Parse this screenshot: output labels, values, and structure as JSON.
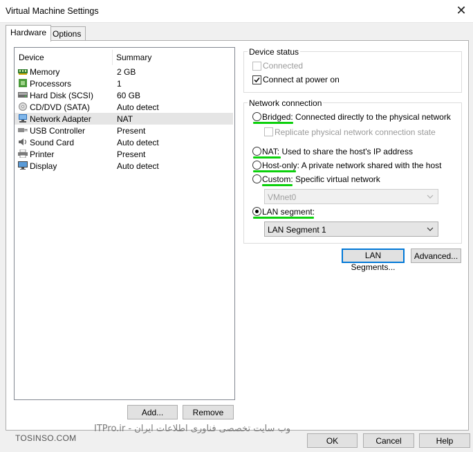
{
  "window": {
    "title": "Virtual Machine Settings",
    "close_glyph": "✕"
  },
  "tabs": [
    {
      "label": "Hardware"
    },
    {
      "label": "Options"
    }
  ],
  "device_list": {
    "col_device": "Device",
    "col_summary": "Summary",
    "rows": [
      {
        "name": "Memory",
        "summary": "2 GB",
        "icon": "memory-icon"
      },
      {
        "name": "Processors",
        "summary": "1",
        "icon": "processor-icon"
      },
      {
        "name": "Hard Disk (SCSI)",
        "summary": "60 GB",
        "icon": "hard-disk-icon"
      },
      {
        "name": "CD/DVD (SATA)",
        "summary": "Auto detect",
        "icon": "cd-dvd-icon"
      },
      {
        "name": "Network Adapter",
        "summary": "NAT",
        "icon": "network-adapter-icon"
      },
      {
        "name": "USB Controller",
        "summary": "Present",
        "icon": "usb-icon"
      },
      {
        "name": "Sound Card",
        "summary": "Auto detect",
        "icon": "sound-card-icon"
      },
      {
        "name": "Printer",
        "summary": "Present",
        "icon": "printer-icon"
      },
      {
        "name": "Display",
        "summary": "Auto detect",
        "icon": "display-icon"
      }
    ],
    "add_label": "Add...",
    "remove_label": "Remove"
  },
  "device_status": {
    "legend": "Device status",
    "connected": "Connected",
    "connect_at_power_on": "Connect at power on"
  },
  "network_connection": {
    "legend": "Network connection",
    "bridged_key": "Bridged:",
    "bridged_desc": "Connected directly to the physical network",
    "replicate": "Replicate physical network connection state",
    "nat_key": "NAT:",
    "nat_desc": "Used to share the host's IP address",
    "hostonly_key": "Host-only:",
    "hostonly_desc": "A private network shared with the host",
    "custom_key": "Custom:",
    "custom_desc": "Specific virtual network",
    "custom_value": "VMnet0",
    "lan_key": "LAN segment:",
    "lan_value": "LAN Segment 1"
  },
  "buttons": {
    "lan_segments": "LAN Segments...",
    "advanced": "Advanced...",
    "ok": "OK",
    "cancel": "Cancel",
    "help": "Help"
  },
  "watermark": {
    "site": "TOSINSO.COM",
    "banner": "ITPro.ir - وب سایت تخصصی فناوری اطلاعات ایران"
  },
  "colors": {
    "underline": "#0bd00b",
    "default_button_border": "#0078d7"
  }
}
